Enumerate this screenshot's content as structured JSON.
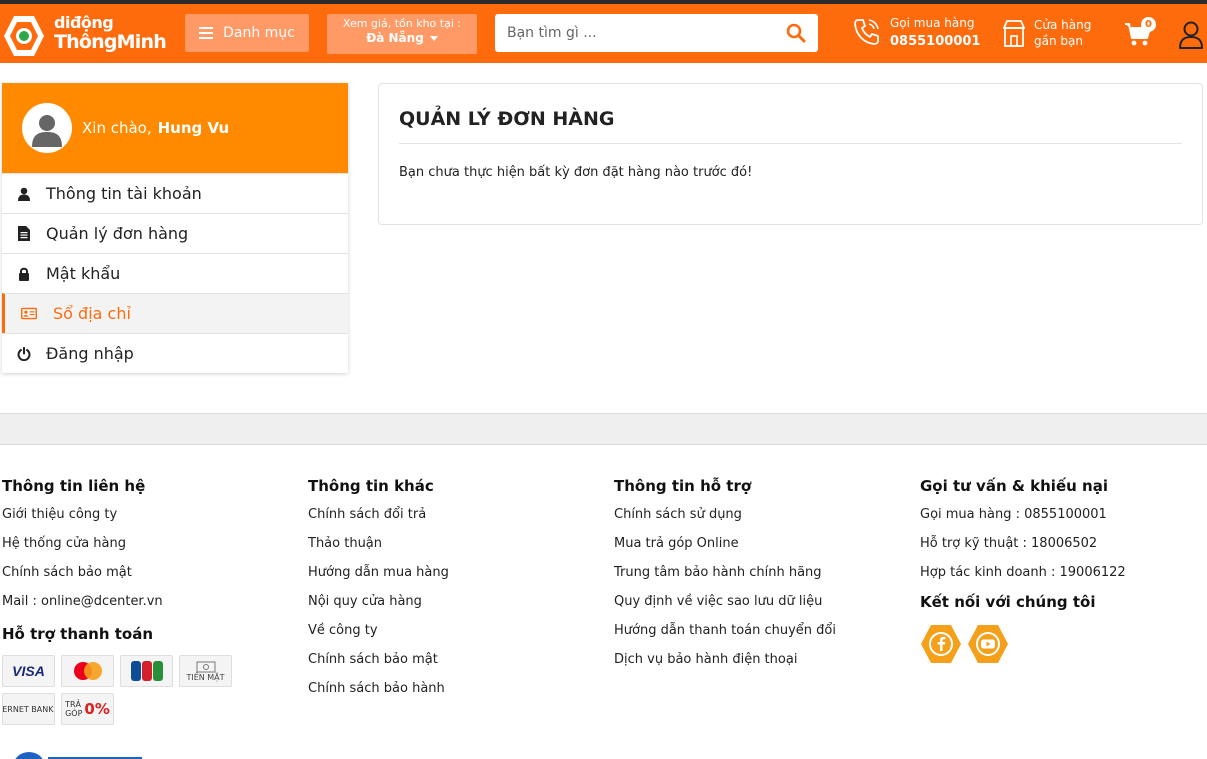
{
  "header": {
    "logo": {
      "line1": "diđộng",
      "line2": "ThôngMinh"
    },
    "menu_label": "Danh mục",
    "location": {
      "label": "Xem giá, tồn kho tại :",
      "value": "Đà Nẵng"
    },
    "search": {
      "placeholder": "Bạn tìm gì ..."
    },
    "hotline": {
      "label": "Gọi mua hàng",
      "number": "0855100001"
    },
    "store": {
      "line1": "Cửa hàng",
      "line2": "gần bạn"
    },
    "cart_count": "0",
    "accent_color": "#fe6b0c"
  },
  "sidebar": {
    "greeting": "Xin chào,",
    "user_name": "Hung Vu",
    "header_color": "#ff8a00",
    "items": [
      {
        "label": "Thông tin tài khoản",
        "icon": "user-icon"
      },
      {
        "label": "Quản lý đơn hàng",
        "icon": "document-icon"
      },
      {
        "label": "Mật khẩu",
        "icon": "lock-icon"
      },
      {
        "label": "Sổ địa chỉ",
        "icon": "address-card-icon"
      },
      {
        "label": "Đăng nhập",
        "icon": "power-icon"
      }
    ]
  },
  "main": {
    "title": "QUẢN LÝ ĐƠN HÀNG",
    "message": "Bạn chưa thực hiện bất kỳ đơn đặt hàng nào trước đó!"
  },
  "footer": {
    "contact": {
      "title": "Thông tin liên hệ",
      "links": [
        "Giới thiệu công ty",
        "Hệ thống cửa hàng",
        "Chính sách bảo mật",
        "Mail : online@dcenter.vn"
      ]
    },
    "payment": {
      "title": "Hỗ trợ thanh toán",
      "cards": [
        "VISA",
        "mastercard",
        "JCB",
        "TIỀN MẶT",
        "INTERNET BANKING",
        "TRẢ GÓP 0%"
      ],
      "installment_line1": "TRẢ",
      "installment_line2": "GÓP",
      "installment_rate": "0%"
    },
    "other": {
      "title": "Thông tin khác",
      "links": [
        "Chính sách đổi trả",
        "Thảo thuận",
        "Hướng dẫn mua hàng",
        "Nội quy cửa hàng",
        "Về công ty",
        "Chính sách bảo mật",
        "Chính sách bảo hành"
      ]
    },
    "support": {
      "title": "Thông tin hỗ trợ",
      "links": [
        "Chính sách sử dụng",
        "Mua trả góp Online",
        "Trung tâm bảo hành chính hãng",
        "Quy định về việc sao lưu dữ liệu",
        "Hướng dẫn thanh toán chuyển đổi",
        "Dịch vụ bảo hành điện thoại"
      ]
    },
    "consult": {
      "title": "Gọi tư vấn & khiếu nại",
      "lines": [
        "Gọi mua hàng : 0855100001",
        "Hỗ trợ kỹ thuật : 18006502",
        "Hợp tác kinh doanh : 19006122"
      ],
      "social_title": "Kết nối với chúng tôi",
      "social": [
        "facebook-icon",
        "youtube-icon"
      ]
    }
  }
}
